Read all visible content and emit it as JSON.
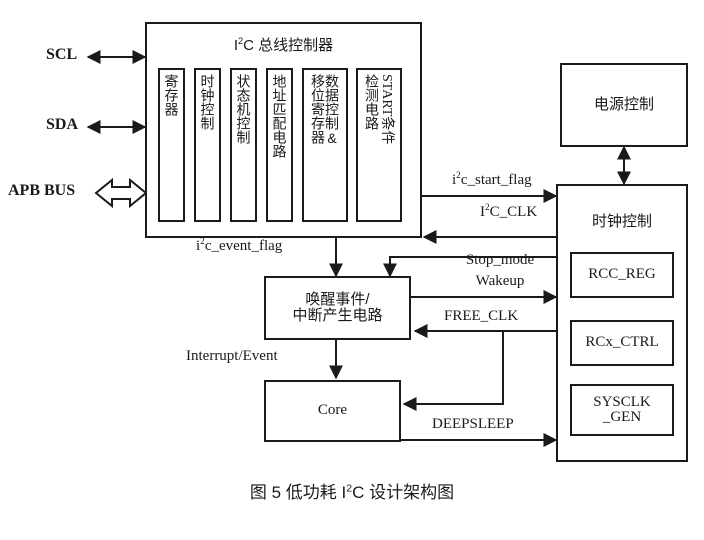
{
  "figure": {
    "caption": "图 5    低功耗 I²C 设计架构图",
    "caption_prefix": "图 5",
    "caption_text": "低功耗 I²C 设计架构图"
  },
  "pins": [
    {
      "label": "SCL",
      "arrow": "bidirectional-solid"
    },
    {
      "label": "SDA",
      "arrow": "bidirectional-solid"
    },
    {
      "label": "APB BUS",
      "arrow": "bidirectional-hollow"
    }
  ],
  "blocks": {
    "i2c_controller": {
      "title": "I²C 总线控制器",
      "submodules": [
        {
          "name": "register",
          "lines": [
            "寄存器"
          ]
        },
        {
          "name": "clock-control",
          "lines": [
            "时钟控制"
          ]
        },
        {
          "name": "state-machine",
          "lines": [
            "状态机控制"
          ]
        },
        {
          "name": "address-match",
          "lines": [
            "地址匹配电路"
          ]
        },
        {
          "name": "data-shift",
          "lines": [
            "数据控制&",
            "移位寄存器"
          ]
        },
        {
          "name": "start-detect",
          "lines": [
            "START条件",
            "检测电路"
          ]
        }
      ]
    },
    "power_control": {
      "title": "电源控制"
    },
    "clock_control": {
      "title": "时钟控制",
      "submodules": [
        {
          "name": "rcc-reg",
          "label": "RCC_REG"
        },
        {
          "name": "rcx-ctrl",
          "label": "RCx_CTRL"
        },
        {
          "name": "sysclk-gen",
          "label": "SYSCLK\n_GEN"
        }
      ]
    },
    "wakeup_interrupt": {
      "title": "唤醒事件/\n中断产生电路"
    },
    "core": {
      "title": "Core"
    }
  },
  "signals": [
    {
      "name": "i2c-start-flag",
      "label": "i²c_start_flag",
      "direction": "i2c-to-clock"
    },
    {
      "name": "i2c-clk",
      "label": "I²C_CLK",
      "direction": "clock-to-i2c"
    },
    {
      "name": "i2c-event-flag",
      "label": "i²c_event_flag",
      "direction": "i2c-to-wakeup"
    },
    {
      "name": "stop-mode-wakeup",
      "label": "Stop_mode\nWakeup",
      "line1": "Stop_mode",
      "line2": "Wakeup",
      "direction": "wakeup-to-clock"
    },
    {
      "name": "free-clk",
      "label": "FREE_CLK",
      "direction": "clock-to-wakeup"
    },
    {
      "name": "interrupt-event",
      "label": "Interrupt/Event",
      "direction": "wakeup-to-core"
    },
    {
      "name": "deepsleep",
      "label": "DEEPSLEEP",
      "direction": "core-to-clock"
    }
  ],
  "colors": {
    "stroke": "#1a1a1a",
    "background": "#ffffff"
  }
}
